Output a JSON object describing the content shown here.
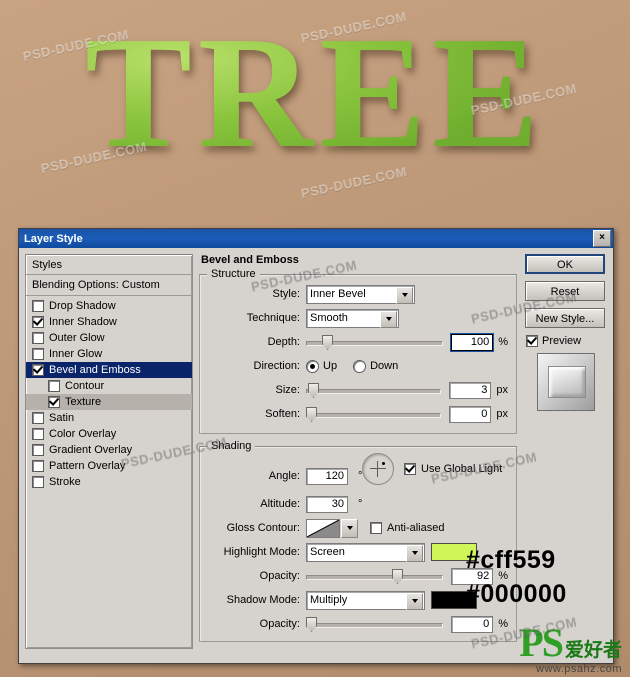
{
  "artwork": {
    "text": "TREE",
    "background_color": "#bd9a76"
  },
  "watermarks": {
    "light": "PSD-DUDE.COM",
    "dark": "PSD-DUDE.COM"
  },
  "dialog": {
    "title": "Layer Style",
    "close_label": "×",
    "styles_panel": {
      "header": "Styles",
      "blending_options": "Blending Options: Custom",
      "effects": [
        {
          "label": "Drop Shadow",
          "checked": false,
          "selected": false,
          "sub": false
        },
        {
          "label": "Inner Shadow",
          "checked": true,
          "selected": false,
          "sub": false
        },
        {
          "label": "Outer Glow",
          "checked": false,
          "selected": false,
          "sub": false
        },
        {
          "label": "Inner Glow",
          "checked": false,
          "selected": false,
          "sub": false
        },
        {
          "label": "Bevel and Emboss",
          "checked": true,
          "selected": true,
          "sub": false
        },
        {
          "label": "Contour",
          "checked": false,
          "selected": false,
          "sub": true
        },
        {
          "label": "Texture",
          "checked": true,
          "selected": false,
          "sub": true,
          "highlight": true
        },
        {
          "label": "Satin",
          "checked": false,
          "selected": false,
          "sub": false
        },
        {
          "label": "Color Overlay",
          "checked": false,
          "selected": false,
          "sub": false
        },
        {
          "label": "Gradient Overlay",
          "checked": false,
          "selected": false,
          "sub": false
        },
        {
          "label": "Pattern Overlay",
          "checked": false,
          "selected": false,
          "sub": false
        },
        {
          "label": "Stroke",
          "checked": false,
          "selected": false,
          "sub": false
        }
      ]
    },
    "main": {
      "section_title": "Bevel and Emboss",
      "structure": {
        "legend": "Structure",
        "style_label": "Style:",
        "style_value": "Inner Bevel",
        "technique_label": "Technique:",
        "technique_value": "Smooth",
        "depth_label": "Depth:",
        "depth_value": "100",
        "depth_unit": "%",
        "direction_label": "Direction:",
        "direction_up": "Up",
        "direction_down": "Down",
        "direction_selected": "Up",
        "size_label": "Size:",
        "size_value": "3",
        "size_unit": "px",
        "soften_label": "Soften:",
        "soften_value": "0",
        "soften_unit": "px"
      },
      "shading": {
        "legend": "Shading",
        "angle_label": "Angle:",
        "angle_value": "120",
        "angle_unit": "°",
        "use_global_light": "Use Global Light",
        "use_global_light_checked": true,
        "altitude_label": "Altitude:",
        "altitude_value": "30",
        "altitude_unit": "°",
        "gloss_contour_label": "Gloss Contour:",
        "anti_aliased": "Anti-aliased",
        "anti_aliased_checked": false,
        "highlight_mode_label": "Highlight Mode:",
        "highlight_mode_value": "Screen",
        "highlight_color": "#cff559",
        "highlight_opacity_label": "Opacity:",
        "highlight_opacity_value": "92",
        "highlight_opacity_unit": "%",
        "shadow_mode_label": "Shadow Mode:",
        "shadow_mode_value": "Multiply",
        "shadow_color": "#000000",
        "shadow_opacity_label": "Opacity:",
        "shadow_opacity_value": "0",
        "shadow_opacity_unit": "%"
      }
    },
    "buttons": {
      "ok": "OK",
      "reset": "Reset",
      "new_style": "New Style...",
      "preview_label": "Preview",
      "preview_checked": true
    }
  },
  "color_codes": {
    "highlight": "#cff559",
    "shadow": "#000000"
  },
  "brand": {
    "ps": "PS",
    "cn": "爱好者",
    "url": "www.psahz.com"
  }
}
